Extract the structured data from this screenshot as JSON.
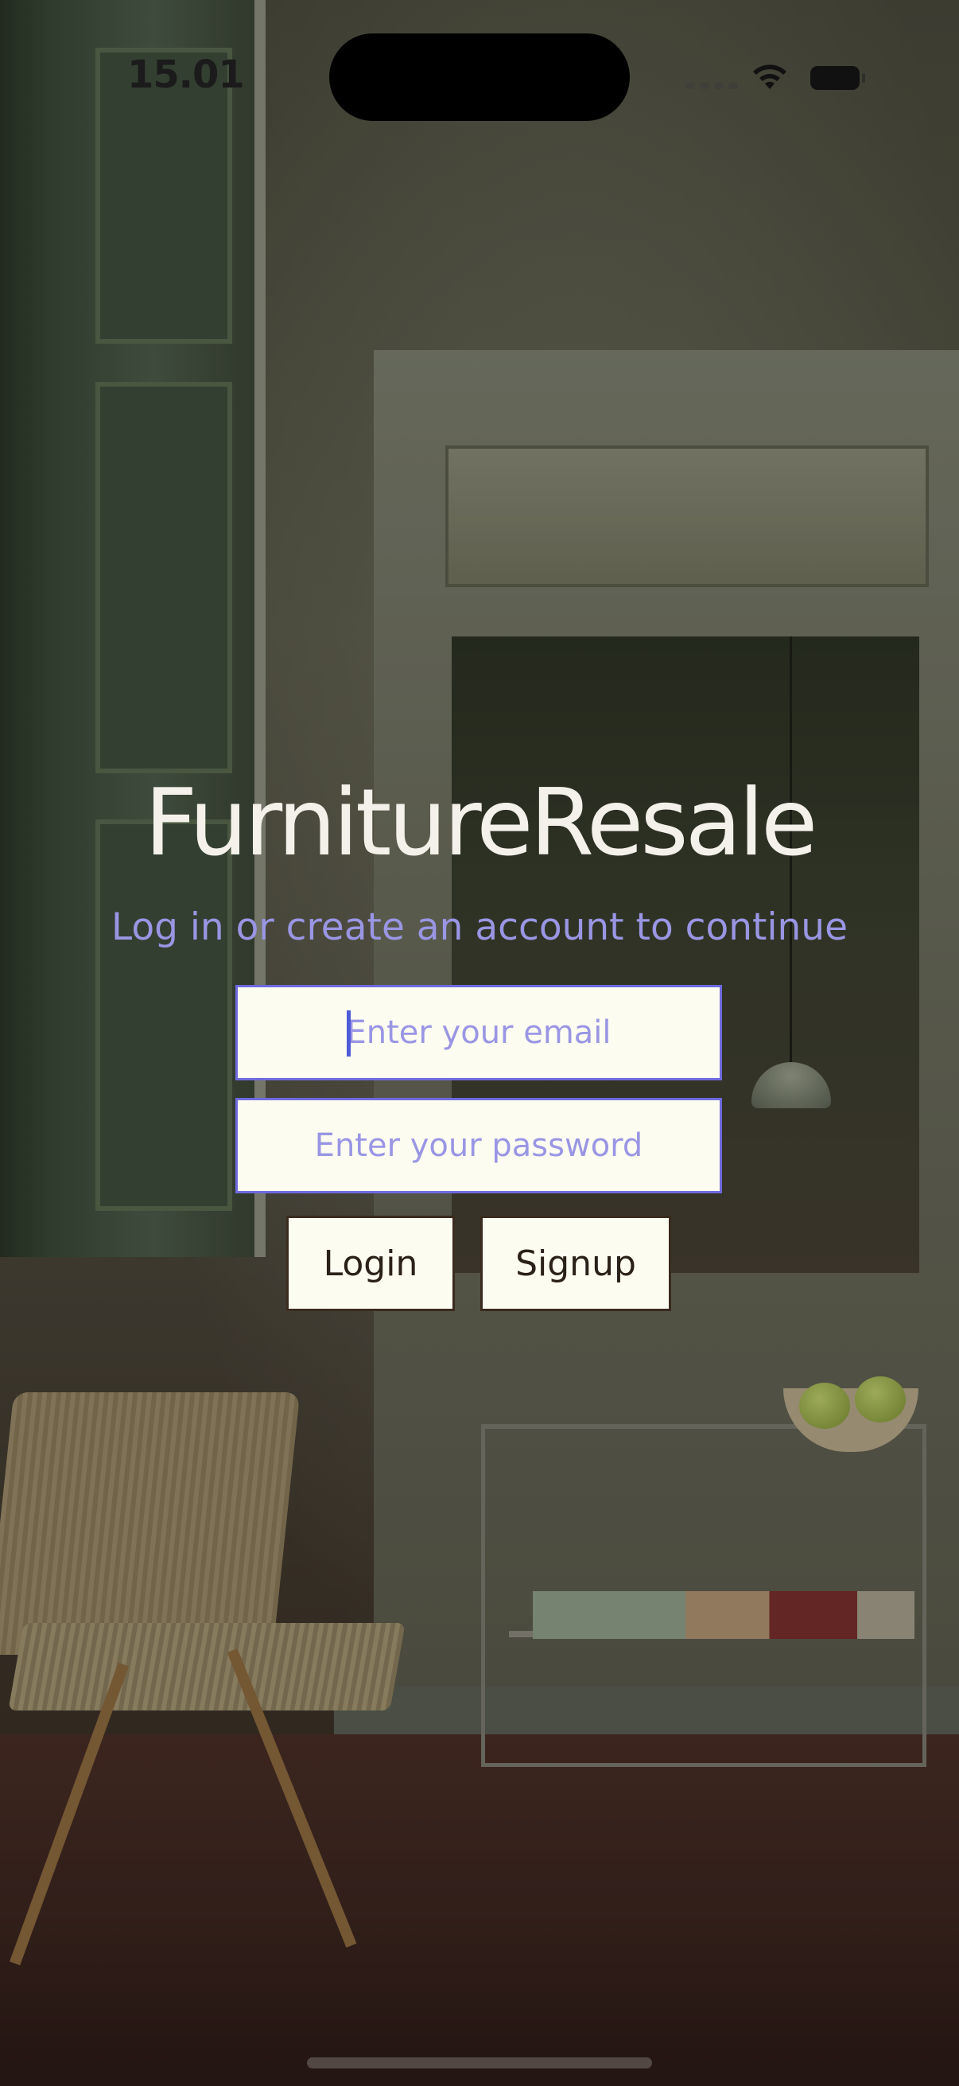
{
  "status_bar": {
    "time": "15.01"
  },
  "app": {
    "title": "FurnitureResale",
    "subtitle": "Log in or create an account to continue"
  },
  "form": {
    "email": {
      "value": "",
      "placeholder": "Enter your email",
      "focused": true
    },
    "password": {
      "value": "",
      "placeholder": "Enter your password"
    },
    "login_label": "Login",
    "signup_label": "Signup"
  },
  "icons": [
    "wifi-icon",
    "battery-icon",
    "cellular-signal-icon"
  ],
  "colors": {
    "accent": "#9a96e4",
    "field_border": "#6f6ae0",
    "field_background": "#fdfcf1",
    "button_border": "#3a2b1e",
    "title_text": "#f4f1ea"
  }
}
